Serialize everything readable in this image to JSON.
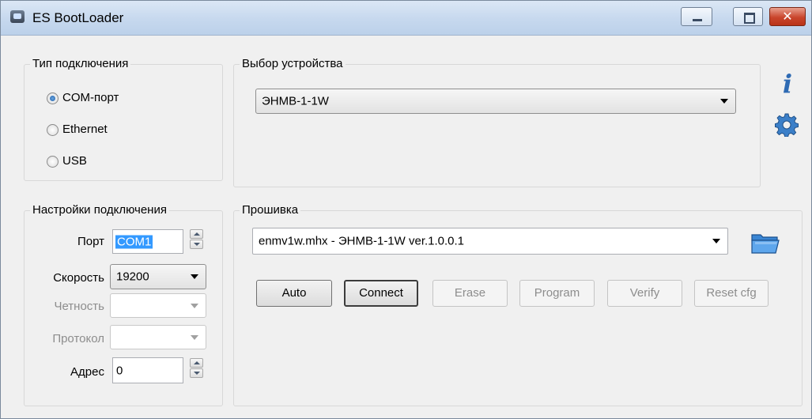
{
  "window": {
    "title": "ES BootLoader"
  },
  "connection_type": {
    "legend": "Тип подключения",
    "options": [
      {
        "label": "COM-порт",
        "selected": true
      },
      {
        "label": "Ethernet",
        "selected": false
      },
      {
        "label": "USB",
        "selected": false
      }
    ]
  },
  "device_select": {
    "legend": "Выбор устройства",
    "selected": "ЭНМВ-1-1W"
  },
  "connection_settings": {
    "legend": "Настройки подключения",
    "port_label": "Порт",
    "port_value": "COM1",
    "speed_label": "Скорость",
    "speed_value": "19200",
    "parity_label": "Четность",
    "parity_value": "",
    "protocol_label": "Протокол",
    "protocol_value": "",
    "address_label": "Адрес",
    "address_value": "0"
  },
  "firmware": {
    "legend": "Прошивка",
    "selected_file": "enmv1w.mhx  - ЭНМВ-1-1W ver.1.0.0.1",
    "buttons": {
      "auto": "Auto",
      "connect": "Connect",
      "erase": "Erase",
      "program": "Program",
      "verify": "Verify",
      "reset_cfg": "Reset cfg"
    }
  },
  "icons": {
    "info": "info-icon",
    "settings": "gear-icon",
    "open_folder": "folder-open-icon",
    "app": "app-icon"
  },
  "colors": {
    "accent_blue": "#2e6ab3",
    "selection": "#3399ff",
    "close_button": "#c9452c"
  }
}
